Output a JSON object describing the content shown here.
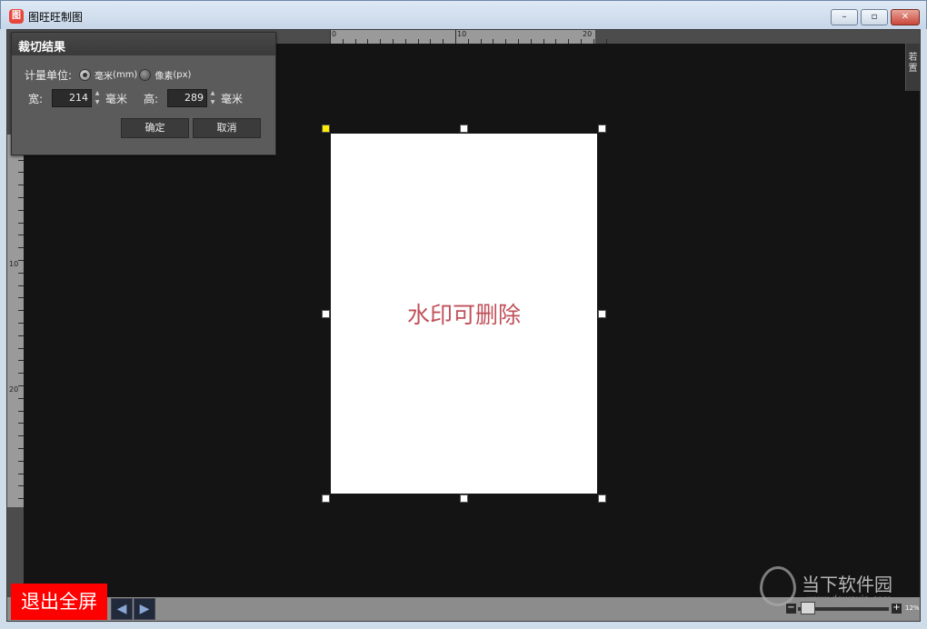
{
  "window": {
    "title": "图旺旺制图",
    "minimize_label": "–",
    "maximize_label": "▫",
    "close_label": "✕"
  },
  "ruler": {
    "h_labels": [
      "0",
      "10",
      "20"
    ],
    "v_labels": [
      "10",
      "20"
    ]
  },
  "side_tab": {
    "label": "若置"
  },
  "crop_panel": {
    "title": "裁切结果",
    "unit_label": "计量单位:",
    "unit_mm": "毫米",
    "unit_mm_suffix": "(mm)",
    "unit_px": "像素",
    "unit_px_suffix": "(px)",
    "selected_unit": "mm",
    "width_label": "宽:",
    "width_value": "214",
    "width_unit": "毫米",
    "height_label": "高:",
    "height_value": "289",
    "height_unit": "毫米",
    "ok_label": "确定",
    "cancel_label": "取消"
  },
  "canvas": {
    "watermark": "水印可删除",
    "handle_color_active": "#ffee00"
  },
  "bottom": {
    "exit_fullscreen_label": "退出全屏",
    "prev_label": "◀",
    "next_label": "▶",
    "zoom_minus": "−",
    "zoom_plus": "+",
    "zoom_value": "12%"
  },
  "logo": {
    "name": "当下软件园",
    "url": "www.downxia.com"
  }
}
